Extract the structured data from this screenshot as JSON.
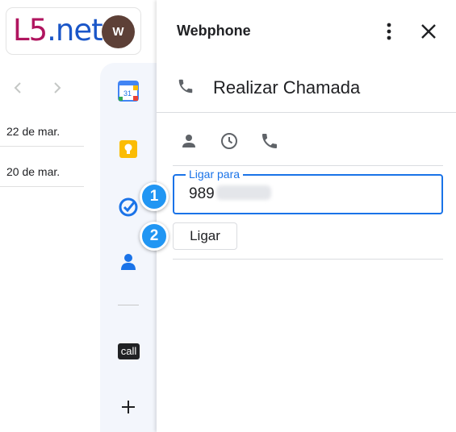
{
  "logo": {
    "part1": "L5",
    "dot": ".",
    "part2": "net"
  },
  "account": {
    "avatar_initial": "W",
    "avatar_color": "#5d4037"
  },
  "mail_list": {
    "dates": [
      "22 de mar.",
      "20 de mar."
    ]
  },
  "side_rail": {
    "icons": [
      "calendar-icon",
      "keep-icon",
      "tasks-icon",
      "contacts-icon",
      "call-app-icon",
      "add-icon"
    ],
    "calendar_day": "31",
    "call_label": "call"
  },
  "panel": {
    "title": "Webphone",
    "section_title": "Realizar Chamada",
    "tabs": [
      "contact-tab",
      "history-tab",
      "dialer-tab"
    ],
    "field_label": "Ligar para",
    "field_value": "989",
    "call_button_label": "Ligar",
    "accent_color": "#1a73e8"
  },
  "callouts": {
    "first": "1",
    "second": "2",
    "color": "#2196f3"
  }
}
